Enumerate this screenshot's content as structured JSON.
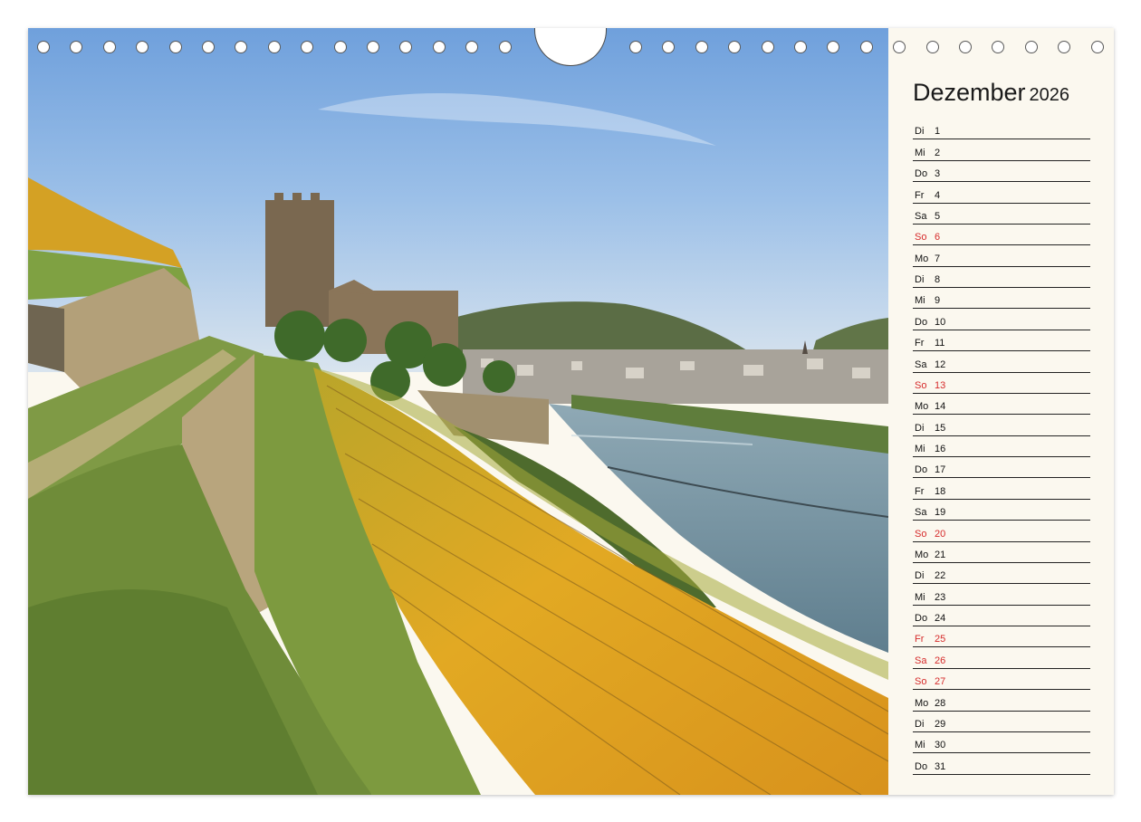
{
  "calendar": {
    "month": "Dezember",
    "year": "2026",
    "days": [
      {
        "name": "Di",
        "num": "1",
        "red": false
      },
      {
        "name": "Mi",
        "num": "2",
        "red": false
      },
      {
        "name": "Do",
        "num": "3",
        "red": false
      },
      {
        "name": "Fr",
        "num": "4",
        "red": false
      },
      {
        "name": "Sa",
        "num": "5",
        "red": false
      },
      {
        "name": "So",
        "num": "6",
        "red": true
      },
      {
        "name": "Mo",
        "num": "7",
        "red": false
      },
      {
        "name": "Di",
        "num": "8",
        "red": false
      },
      {
        "name": "Mi",
        "num": "9",
        "red": false
      },
      {
        "name": "Do",
        "num": "10",
        "red": false
      },
      {
        "name": "Fr",
        "num": "11",
        "red": false
      },
      {
        "name": "Sa",
        "num": "12",
        "red": false
      },
      {
        "name": "So",
        "num": "13",
        "red": true
      },
      {
        "name": "Mo",
        "num": "14",
        "red": false
      },
      {
        "name": "Di",
        "num": "15",
        "red": false
      },
      {
        "name": "Mi",
        "num": "16",
        "red": false
      },
      {
        "name": "Do",
        "num": "17",
        "red": false
      },
      {
        "name": "Fr",
        "num": "18",
        "red": false
      },
      {
        "name": "Sa",
        "num": "19",
        "red": false
      },
      {
        "name": "So",
        "num": "20",
        "red": true
      },
      {
        "name": "Mo",
        "num": "21",
        "red": false
      },
      {
        "name": "Di",
        "num": "22",
        "red": false
      },
      {
        "name": "Mi",
        "num": "23",
        "red": false
      },
      {
        "name": "Do",
        "num": "24",
        "red": false
      },
      {
        "name": "Fr",
        "num": "25",
        "red": true
      },
      {
        "name": "Sa",
        "num": "26",
        "red": true
      },
      {
        "name": "So",
        "num": "27",
        "red": true
      },
      {
        "name": "Mo",
        "num": "28",
        "red": false
      },
      {
        "name": "Di",
        "num": "29",
        "red": false
      },
      {
        "name": "Mi",
        "num": "30",
        "red": false
      },
      {
        "name": "Do",
        "num": "31",
        "red": false
      }
    ]
  },
  "colors": {
    "holiday_red": "#d62b2b",
    "panel_bg": "#fbf8ef"
  },
  "photo": {
    "subject": "vineyard-castle-river-landscape"
  }
}
